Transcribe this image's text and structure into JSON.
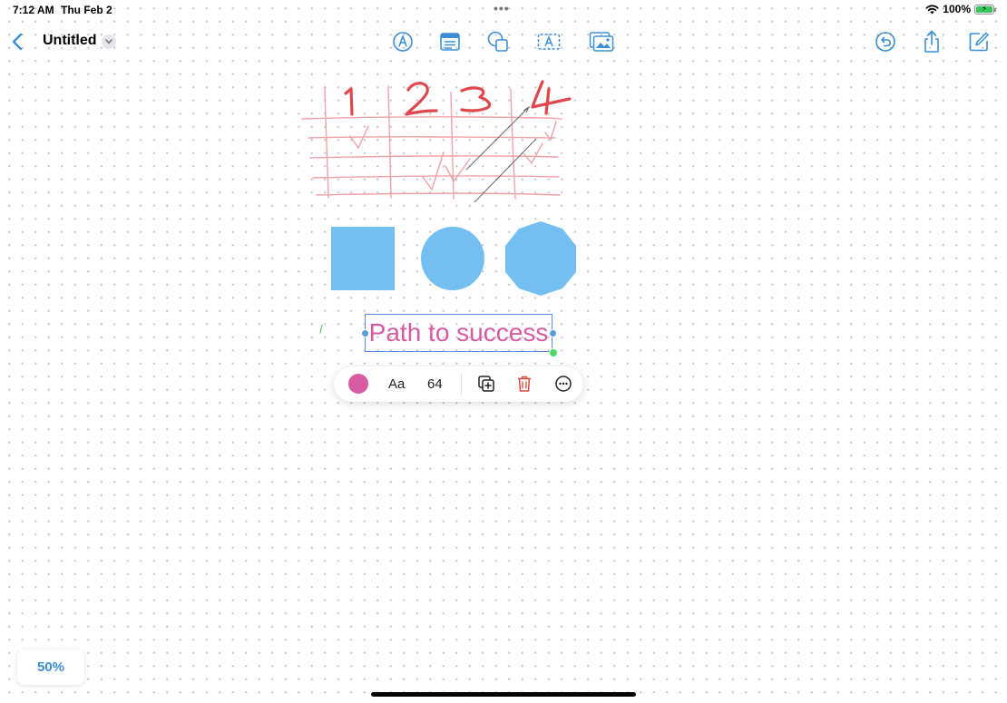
{
  "status_bar": {
    "time": "7:12 AM",
    "date": "Thu Feb 2",
    "battery_percent": "100%",
    "battery_color": "#34c759"
  },
  "toolbar": {
    "back_icon": "chevron-left-icon",
    "title": "Untitled",
    "tools": [
      "pen-tool-icon",
      "sticky-note-icon",
      "shapes-icon",
      "text-box-icon",
      "media-icon"
    ],
    "right_tools": [
      "undo-icon",
      "share-icon",
      "new-board-icon"
    ],
    "accent_color": "#3a8fd4"
  },
  "canvas": {
    "handwritten_numbers": [
      "1",
      "2",
      "3",
      "4"
    ],
    "ink_color": "#e0474c",
    "grid_ink_color": "#f0a3a6",
    "shape_fill": "#74bff2",
    "shapes": [
      "square",
      "circle",
      "polygon"
    ],
    "selected_text": "Path to success",
    "text_color": "#d75aa3",
    "selection_color": "#5b8fe0"
  },
  "format_bar": {
    "color_hex": "#d75aa3",
    "font_label": "Aa",
    "font_size": "64",
    "duplicate_icon": "duplicate-icon",
    "delete_icon": "trash-icon",
    "delete_color": "#e0473d",
    "more_icon": "more-icon"
  },
  "zoom": {
    "label": "50%"
  }
}
